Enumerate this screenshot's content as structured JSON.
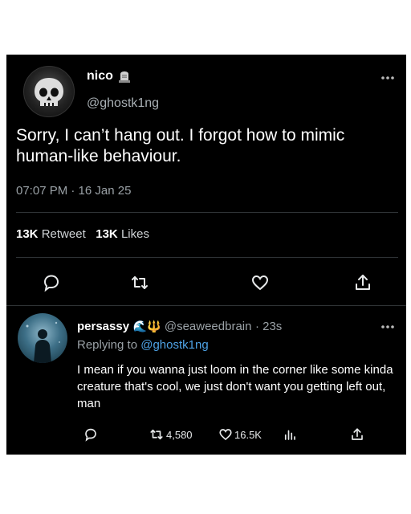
{
  "tweet": {
    "name": "nico",
    "handle": "@ghostk1ng",
    "text": "Sorry, I can’t hang out. I forgot how to mimic human-like behaviour.",
    "timestamp": "07:07 PM · 16 Jan 25",
    "retweet_count": "13K",
    "retweet_label": "Retweet",
    "likes_count": "13K",
    "likes_label": "Likes",
    "more_icon": "more-dots-icon"
  },
  "reply": {
    "name": "persassy",
    "emojis": "🌊🔱",
    "handle": "@seaweedbrain",
    "age": "· 23s",
    "replying_prefix": "Replying to",
    "replying_handle": "@ghostk1ng",
    "text": "I mean if you wanna just loom in the corner like some kinda creature that's cool, we just don't want you getting left out, man",
    "retweets": "4,580",
    "likes": "16.5K"
  },
  "colors": {
    "background": "#000000",
    "link": "#4ea3e6",
    "secondary_text": "#9aa1a6"
  }
}
